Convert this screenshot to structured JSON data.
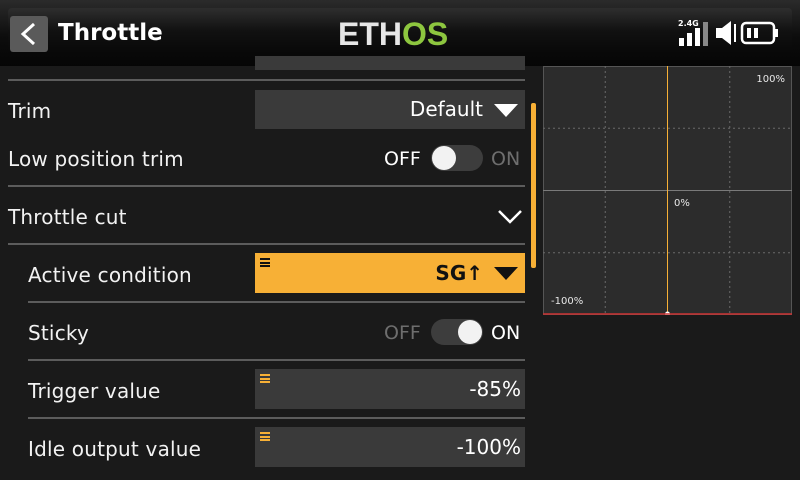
{
  "header": {
    "title": "Throttle",
    "logo_left": "ETH",
    "logo_right": "OS",
    "rf_band": "2.4G"
  },
  "colors": {
    "accent": "#f7b036",
    "logo_green": "#8dc63f",
    "chart_line": "#f7b036",
    "chart_bottom_line": "#cc3333"
  },
  "rows": {
    "trim": {
      "label": "Trim",
      "value": "Default"
    },
    "low_position_trim": {
      "label": "Low position trim",
      "off": "OFF",
      "on": "ON",
      "state": "off"
    },
    "throttle_cut": {
      "label": "Throttle cut",
      "expanded": true
    },
    "active_condition": {
      "label": "Active condition",
      "value": "SG↑"
    },
    "sticky": {
      "label": "Sticky",
      "off": "OFF",
      "on": "ON",
      "state": "on"
    },
    "trigger_value": {
      "label": "Trigger value",
      "value": "-85%"
    },
    "idle_output_value": {
      "label": "Idle output value",
      "value": "-100%"
    }
  },
  "chart": {
    "label_top": "100%",
    "label_mid": "0%",
    "label_bottom": "-100%"
  },
  "chart_data": {
    "type": "line",
    "title": "",
    "xlabel": "",
    "ylabel": "",
    "xlim": [
      -100,
      100
    ],
    "ylim": [
      -100,
      100
    ],
    "grid": true,
    "series": [
      {
        "x": [
          0,
          0
        ],
        "values": [
          -100,
          100
        ]
      }
    ],
    "annotations": [
      "100%",
      "0%",
      "-100%"
    ]
  }
}
